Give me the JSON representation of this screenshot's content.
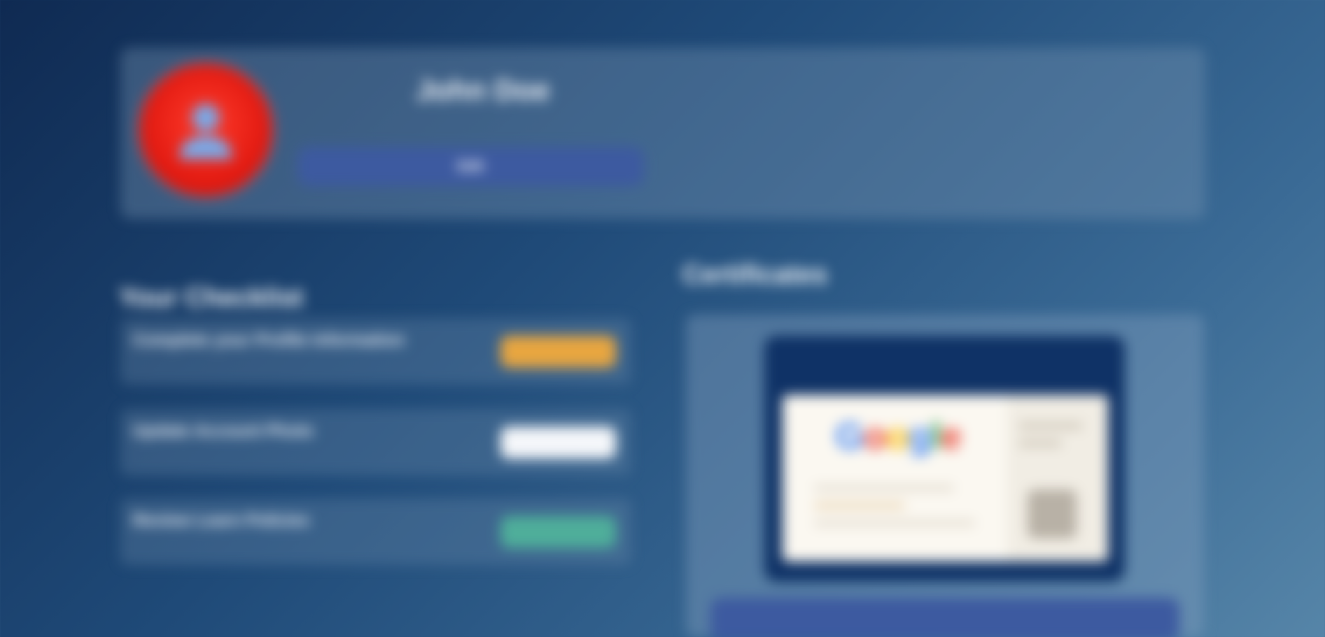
{
  "profile": {
    "name": "John Doe",
    "subtitle": "",
    "button_label": "Edit"
  },
  "checklist": {
    "title": "Your Checklist",
    "tasks": [
      {
        "name": "Complete your Profile Information",
        "meta": "",
        "badge": "",
        "badge_color": "#e8a640"
      },
      {
        "name": "Update Account Photo",
        "meta": "",
        "badge": "",
        "badge_color": "#f5f7fa"
      },
      {
        "name": "Review Learn Policies",
        "meta": "",
        "badge": "",
        "badge_color": "#4fae9a"
      }
    ]
  },
  "certificates": {
    "title": "Certificates",
    "card_header": "",
    "logo_letters": [
      "G",
      "o",
      "o",
      "g",
      "l",
      "e"
    ],
    "button_label": ""
  },
  "colors": {
    "primary_button": "#3d5aa0",
    "avatar_red": "#e31b12",
    "badge_orange": "#e8a640",
    "badge_teal": "#4fae9a",
    "cert_frame": "#0f3266"
  }
}
